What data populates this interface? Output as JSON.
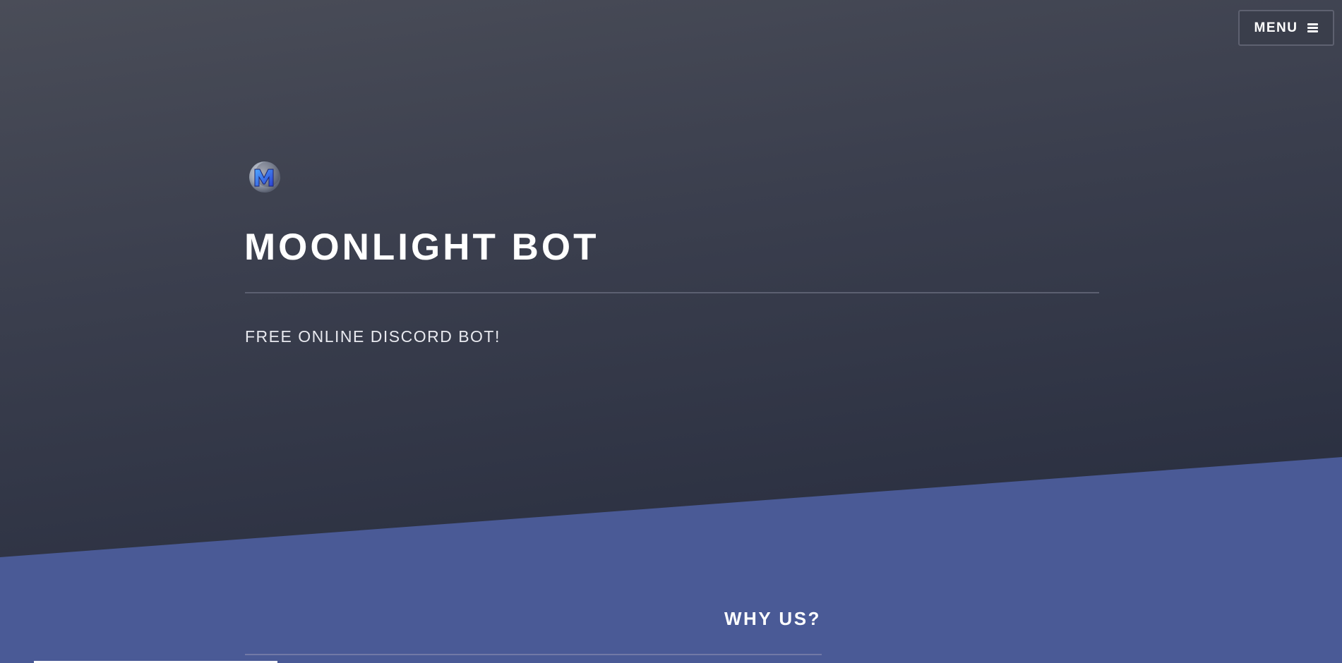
{
  "colors": {
    "hero_top": "#4a4d58",
    "hero_bottom": "#2a2f40",
    "section_blue": "#4a5a96",
    "text": "#ffffff"
  },
  "header": {
    "menu_label": "MENU",
    "menu_icon": "hamburger-icon"
  },
  "hero": {
    "logo_icon": "moonlight-m-logo",
    "title": "MOONLIGHT BOT",
    "tagline": "FREE ONLINE DISCORD BOT!"
  },
  "section": {
    "title": "WHY US?"
  }
}
